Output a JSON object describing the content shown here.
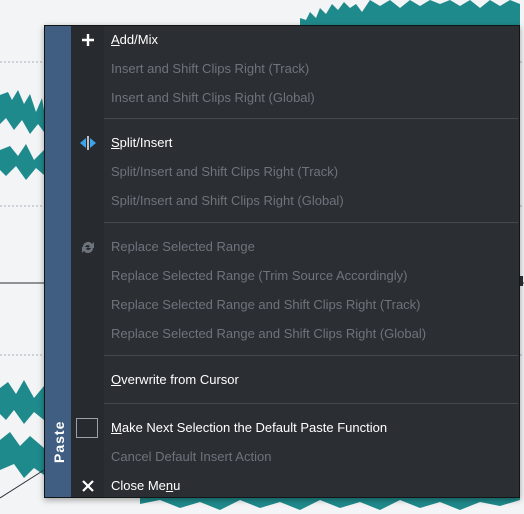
{
  "menu": {
    "side_label": "Paste",
    "items": [
      {
        "label": "Add/Mix",
        "enabled": true,
        "icon": "plus-icon",
        "ul": 0
      },
      {
        "label": "Insert and Shift Clips Right (Track)",
        "enabled": false
      },
      {
        "label": "Insert and Shift Clips Right (Global)",
        "enabled": false
      },
      {
        "label": "Split/Insert",
        "enabled": true,
        "icon": "split-insert-icon"
      },
      {
        "label": "Split/Insert and Shift Clips Right (Track)",
        "enabled": false
      },
      {
        "label": "Split/Insert and Shift Clips Right (Global)",
        "enabled": false
      },
      {
        "label": "Replace Selected Range",
        "enabled": false,
        "icon": "replace-icon"
      },
      {
        "label": "Replace Selected Range (Trim Source Accordingly)",
        "enabled": false
      },
      {
        "label": "Replace Selected Range and Shift Clips Right (Track)",
        "enabled": false
      },
      {
        "label": "Replace Selected Range and Shift Clips Right (Global)",
        "enabled": false
      },
      {
        "label": "Overwrite from Cursor",
        "enabled": true
      },
      {
        "label": "Make Next Selection the Default Paste Function",
        "enabled": true,
        "icon": "checkbox-icon"
      },
      {
        "label": "Cancel Default Insert Action",
        "enabled": false
      },
      {
        "label": "Close Menu",
        "enabled": true,
        "icon": "close-icon"
      }
    ]
  },
  "colors": {
    "menu_bg": "#2b2e33",
    "side_bar": "#3f5e82",
    "accent_blue": "#3ea3e8",
    "waveform": "#1f8a8c"
  }
}
